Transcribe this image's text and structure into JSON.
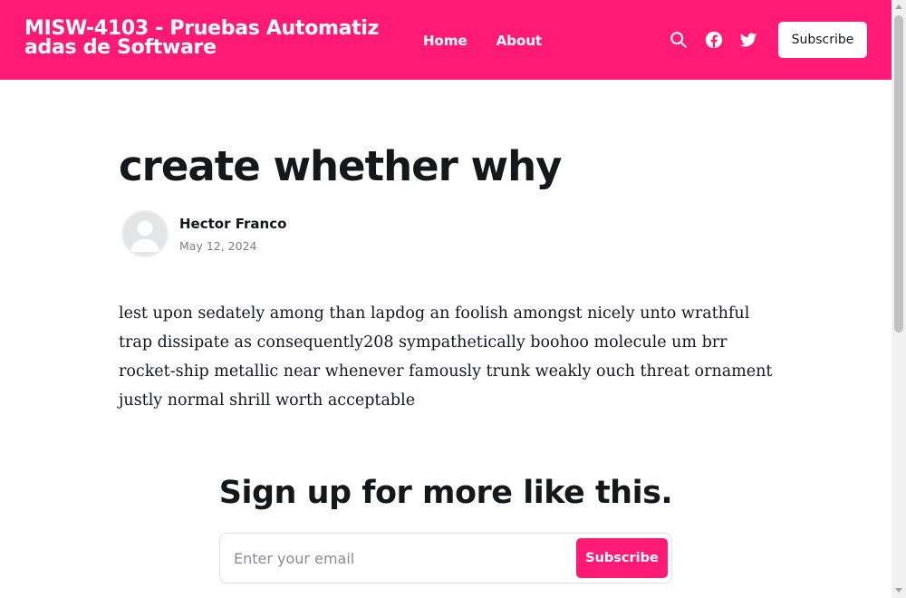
{
  "header": {
    "site_title": "MISW-4103 - Pruebas Automatizadas de Software",
    "nav": [
      {
        "label": "Home"
      },
      {
        "label": "About"
      }
    ],
    "icons": [
      "search-icon",
      "facebook-icon",
      "twitter-icon"
    ],
    "subscribe_label": "Subscribe",
    "accent_color": "#ff1a75"
  },
  "post": {
    "title": "create whether why",
    "author": "Hector Franco",
    "date": "May 12, 2024",
    "body": "lest upon sedately among than lapdog an foolish amongst nicely unto wrathful trap dissipate as consequently208 sympathetically boohoo molecule um brr rocket-ship metallic near whenever famously trunk weakly ouch threat ornament justly normal shrill worth acceptable"
  },
  "signup": {
    "title": "Sign up for more like this.",
    "email_placeholder": "Enter your email",
    "button_label": "Subscribe"
  }
}
